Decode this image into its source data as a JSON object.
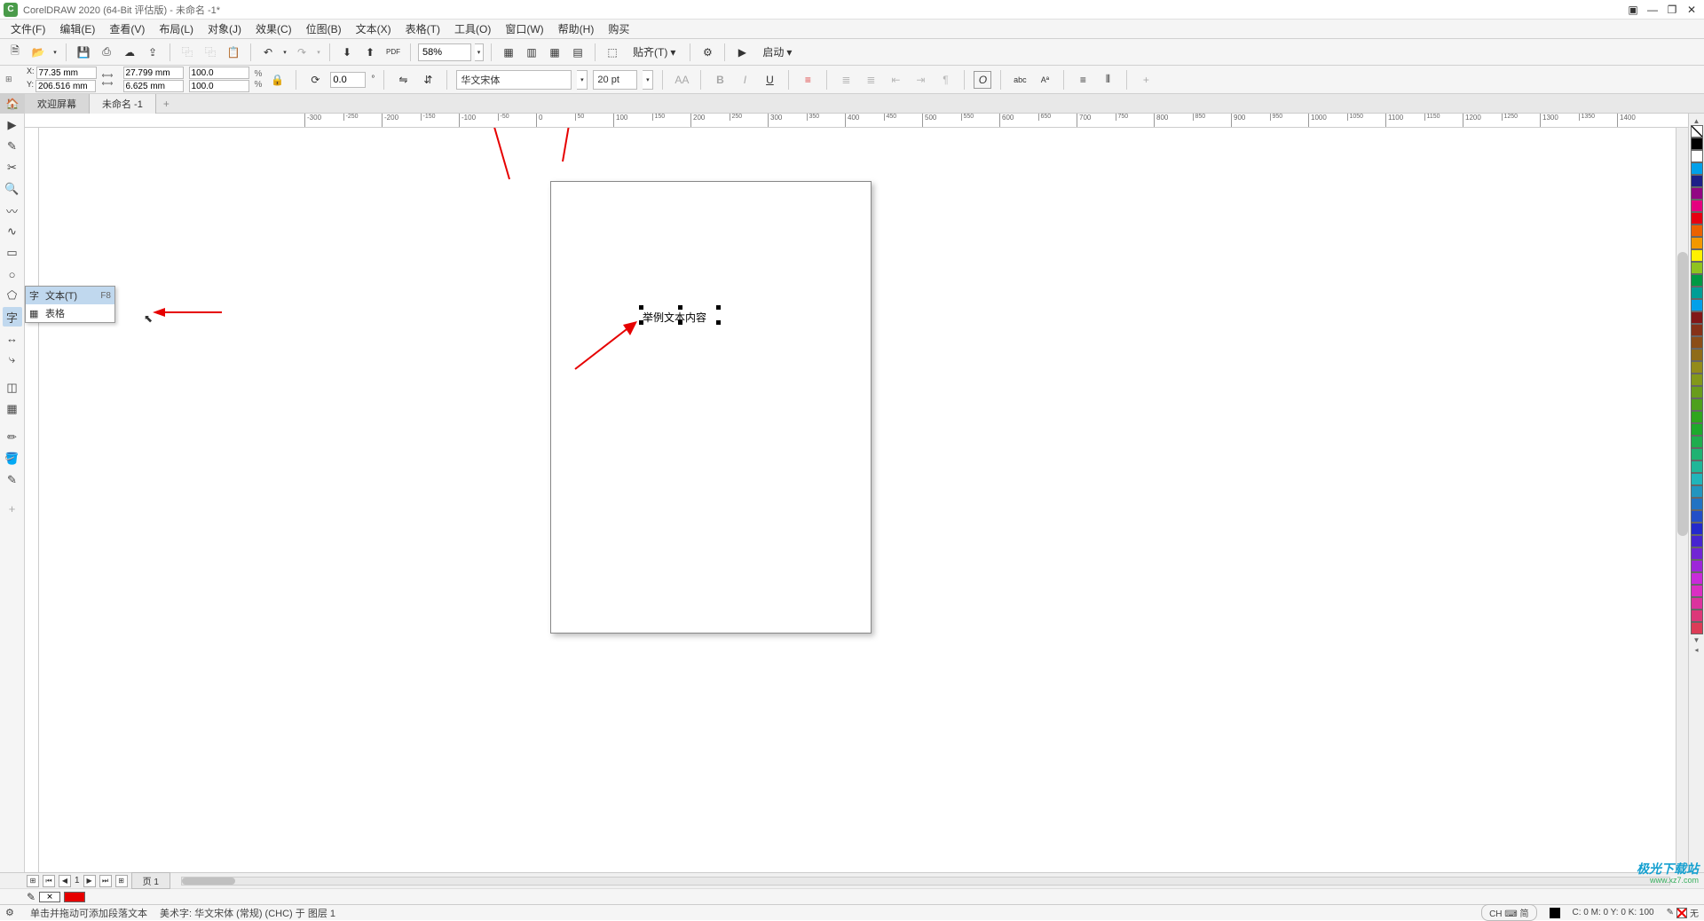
{
  "titlebar": {
    "app": "CorelDRAW 2020 (64-Bit 评估版) - 未命名 -1*"
  },
  "menu": [
    "文件(F)",
    "编辑(E)",
    "查看(V)",
    "布局(L)",
    "对象(J)",
    "效果(C)",
    "位图(B)",
    "文本(X)",
    "表格(T)",
    "工具(O)",
    "窗口(W)",
    "帮助(H)",
    "购买"
  ],
  "toolbar1": {
    "zoom": "58%",
    "align_label": "贴齐(T)",
    "launch_label": "启动"
  },
  "propbar": {
    "x_label": "X:",
    "y_label": "Y:",
    "x": "77.35 mm",
    "y": "206.516 mm",
    "w": "27.799 mm",
    "h": "6.625 mm",
    "sx": "100.0",
    "sy": "100.0",
    "pct": "%",
    "rotation": "0.0",
    "font": "华文宋体",
    "size": "20 pt",
    "circle_o": "O",
    "abc": "abc",
    "A_small": "A"
  },
  "tabs": {
    "welcome": "欢迎屏幕",
    "doc": "未命名 -1"
  },
  "flyout": {
    "text_label": "文本(T)",
    "text_shortcut": "F8",
    "table_label": "表格"
  },
  "canvas": {
    "sample_text": "举例文本内容",
    "unit": "毫米"
  },
  "hruler_ticks": [
    -300,
    -200,
    -100,
    0,
    100,
    200,
    300,
    400,
    500,
    600,
    700,
    800,
    900,
    1000,
    1100,
    1200,
    1300,
    1400
  ],
  "hruler_minor": [
    -250,
    -150,
    -50,
    50,
    150,
    250,
    350,
    450,
    550,
    650,
    750,
    850,
    950,
    1050,
    1150,
    1250,
    1350
  ],
  "pagenav": {
    "page1": "页 1"
  },
  "statusbar": {
    "hint": "单击并拖动可添加段落文本",
    "obj": "美术字:   华文宋体 (常规) (CHC) 于 图层 1",
    "ime": "CH ⌨ 简",
    "cmyk": "C:  0 M:  0 Y:  0 K: 100",
    "nofill": "无"
  },
  "palette_colors": [
    "#000000",
    "#ffffff",
    "#00a0e9",
    "#1d2088",
    "#920783",
    "#e4007f",
    "#e60012",
    "#eb6100",
    "#f39800",
    "#fff100",
    "#8fc31f",
    "#009944",
    "#009e96",
    "#00a0e9"
  ],
  "watermark": {
    "logo": "极光下载站",
    "url": "www.xz7.com"
  }
}
